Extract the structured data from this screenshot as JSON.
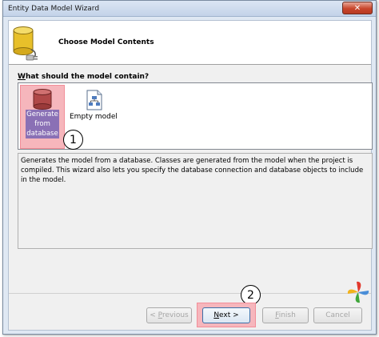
{
  "window": {
    "title": "Entity Data Model Wizard"
  },
  "header": {
    "title": "Choose Model Contents"
  },
  "question": {
    "prefix": "W",
    "rest": "hat should the model contain?"
  },
  "choices": [
    {
      "label_line1": "Generate",
      "label_line2": "from",
      "label_line3": "database",
      "selected": true
    },
    {
      "label": "Empty model",
      "selected": false
    }
  ],
  "annotations": {
    "step1": "1",
    "step2": "2"
  },
  "description": "Generates the model from a database. Classes are generated from the model when the project is compiled. This wizard also lets you specify the database connection and database objects to include in the model.",
  "buttons": {
    "previous": {
      "prefix": "< ",
      "key": "P",
      "rest": "revious",
      "enabled": false
    },
    "next": {
      "key": "N",
      "rest": "ext >",
      "enabled": true
    },
    "finish": {
      "key": "F",
      "rest": "inish",
      "enabled": false
    },
    "cancel": {
      "label": "Cancel",
      "enabled": false
    }
  },
  "colors": {
    "highlight": "#f6b6bc",
    "selection": "#8a70b5",
    "close": "#c8462c"
  }
}
